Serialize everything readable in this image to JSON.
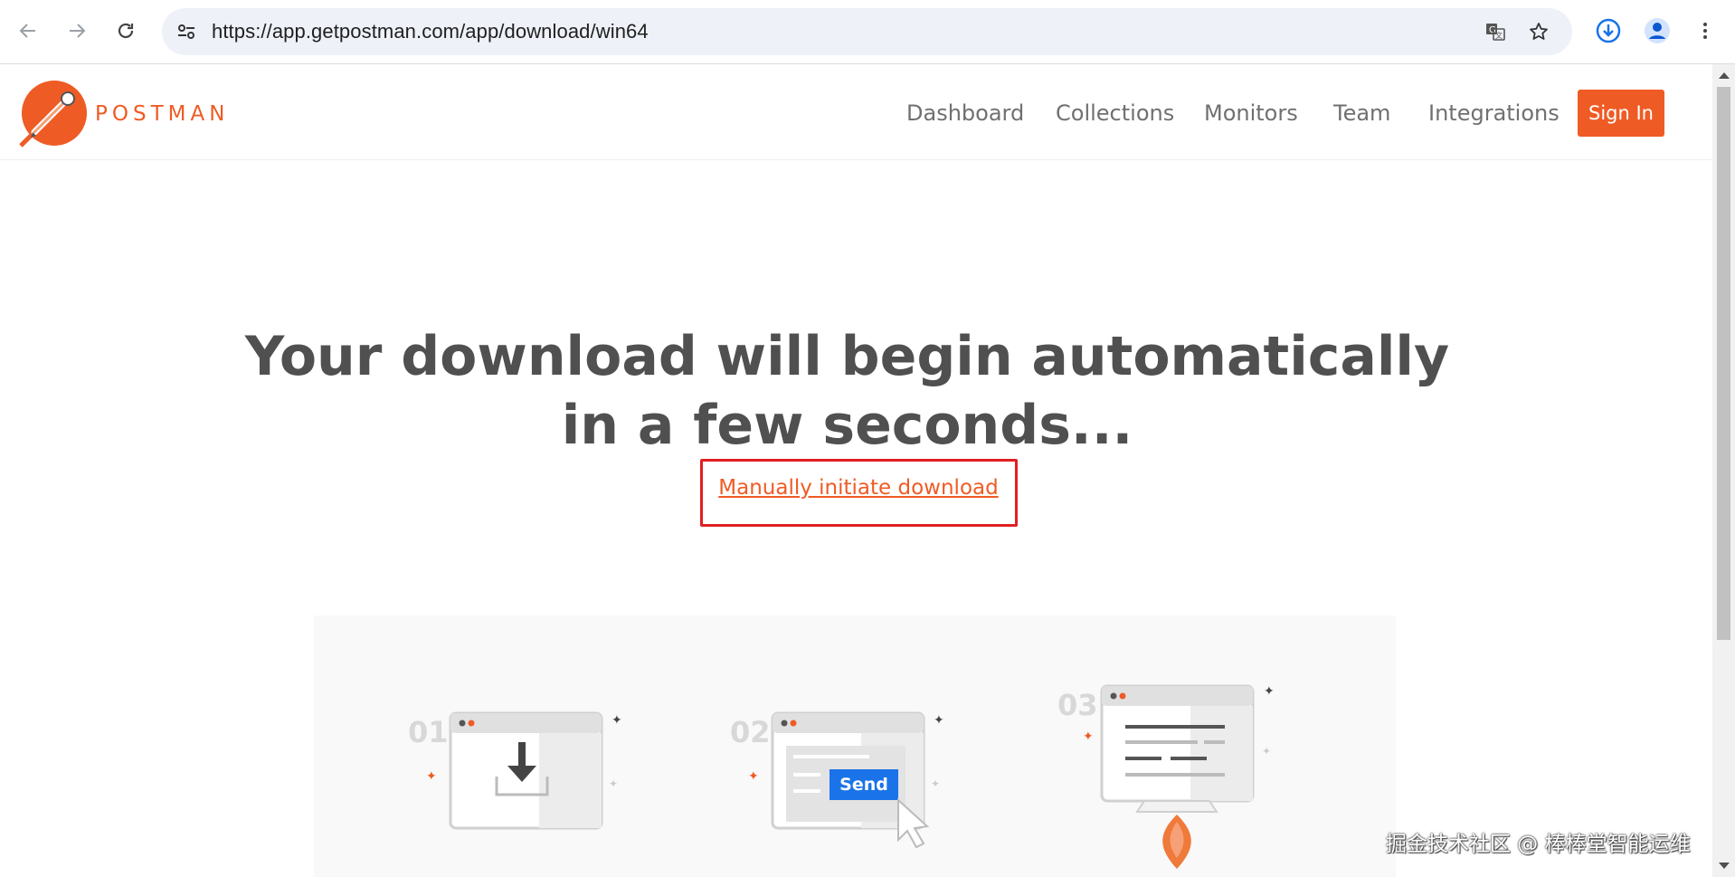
{
  "browser": {
    "url": "https://app.getpostman.com/app/download/win64",
    "back_icon": "back-arrow-icon",
    "forward_icon": "forward-arrow-icon",
    "reload_icon": "reload-icon"
  },
  "site": {
    "logo_text": "POSTMAN",
    "nav": [
      "Dashboard",
      "Collections",
      "Monitors",
      "Team",
      "Integrations"
    ],
    "signin_label": "Sign In",
    "brand_color": "#ef5b25"
  },
  "main": {
    "headline_line1": "Your download will begin automatically",
    "headline_line2": "in a few seconds...",
    "manual_link": "Manually initiate download"
  },
  "steps": [
    {
      "number": "01",
      "icon": "download-window-icon"
    },
    {
      "number": "02",
      "icon": "send-window-icon",
      "button_label": "Send"
    },
    {
      "number": "03",
      "icon": "launch-monitor-icon"
    }
  ],
  "watermark": "掘金技术社区 @ 棒棒堂智能运维"
}
